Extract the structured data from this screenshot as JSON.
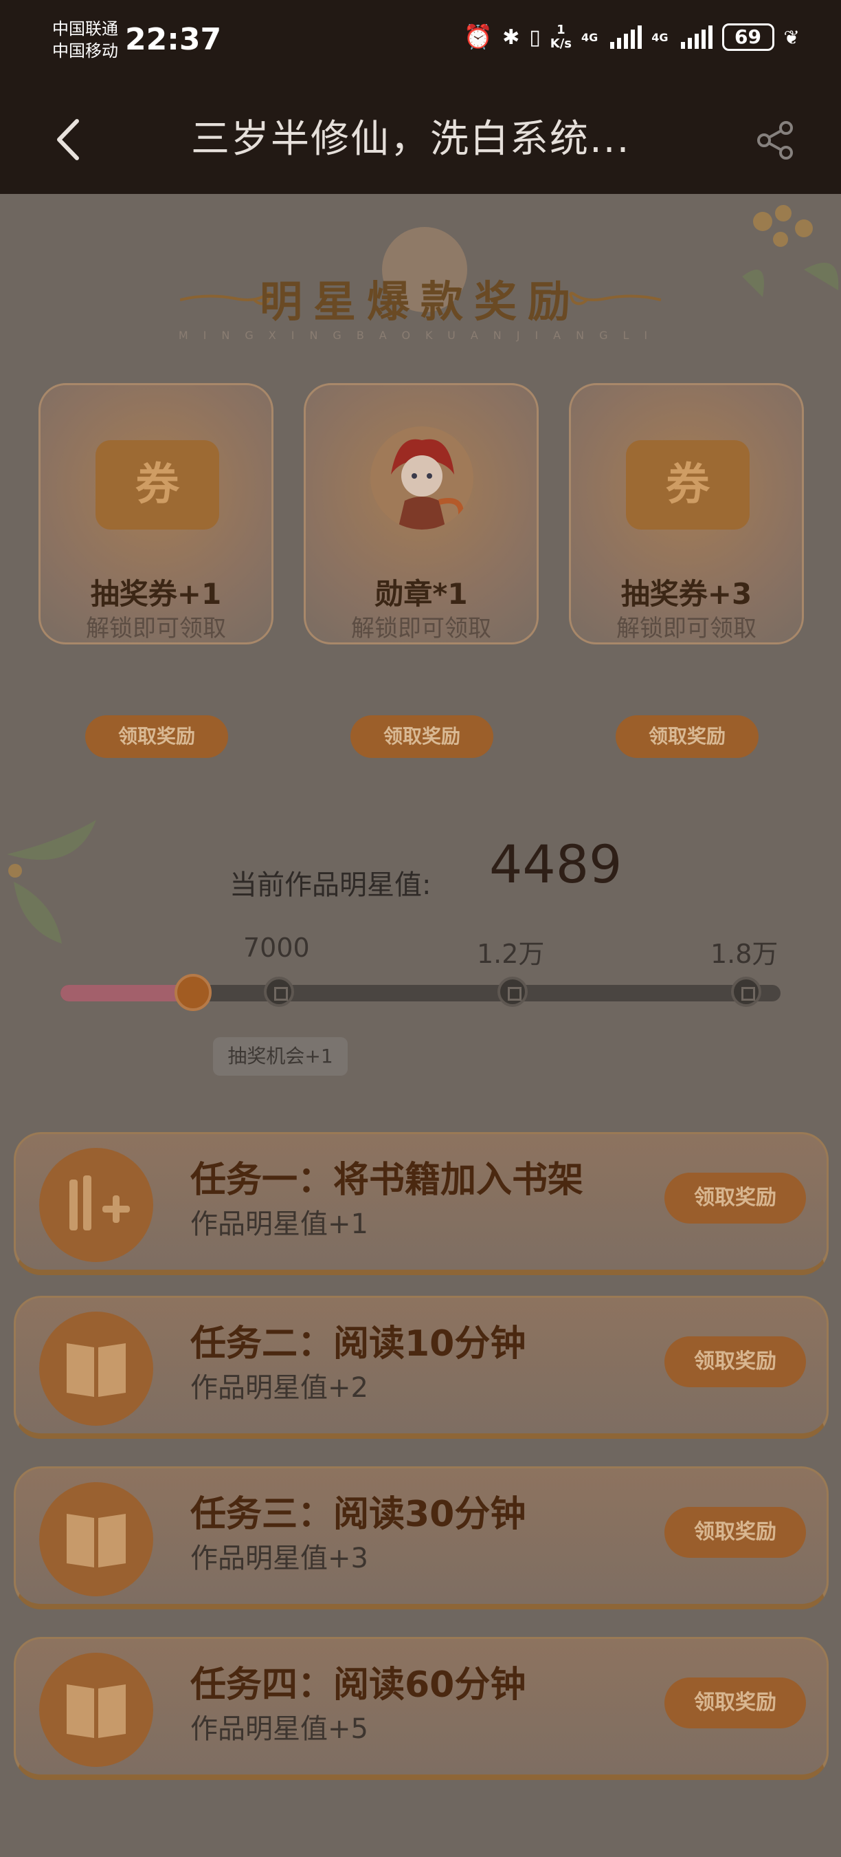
{
  "status_bar": {
    "carrier_1": "中国联通",
    "carrier_2": "中国移动",
    "time": "22:37",
    "net_speed_value": "1",
    "net_speed_unit": "K/s",
    "signal_1": "4G",
    "signal_2": "4G",
    "battery": "69"
  },
  "header": {
    "title": "三岁半修仙，洗白系统..."
  },
  "banner": {
    "title": "明星爆款奖励",
    "subtitle": "MINGXINGBAOKUANJIANGLI"
  },
  "rewards": [
    {
      "icon": "coupon-icon",
      "icon_text": "券",
      "name": "抽奖券+1",
      "hint": "解锁即可领取",
      "button": "领取奖励"
    },
    {
      "icon": "medal-character-icon",
      "name": "勋章*1",
      "hint": "解锁即可领取",
      "button": "领取奖励"
    },
    {
      "icon": "coupon-icon",
      "icon_text": "券",
      "name": "抽奖券+3",
      "hint": "解锁即可领取",
      "button": "领取奖励"
    }
  ],
  "progress": {
    "label": "当前作品明星值:",
    "value": "4489",
    "milestones": [
      "7000",
      "1.2万",
      "1.8万"
    ],
    "fill_fraction": 0.18,
    "milestone_reward": "抽奖机会+1"
  },
  "tasks": [
    {
      "icon": "add-to-shelf-icon",
      "title": "任务一：将书籍加入书架",
      "reward": "作品明星值+1",
      "button": "领取奖励"
    },
    {
      "icon": "book-icon",
      "title": "任务二：阅读10分钟",
      "reward": "作品明星值+2",
      "button": "领取奖励"
    },
    {
      "icon": "book-icon",
      "title": "任务三：阅读30分钟",
      "reward": "作品明星值+3",
      "button": "领取奖励"
    },
    {
      "icon": "book-icon",
      "title": "任务四：阅读60分钟",
      "reward": "作品明星值+5",
      "button": "领取奖励"
    }
  ],
  "colors": {
    "overlay_bg": "#6f6760",
    "header_bg": "#221914",
    "accent_orange": "#9c5f2a",
    "progress_fill": "#a3606b"
  }
}
